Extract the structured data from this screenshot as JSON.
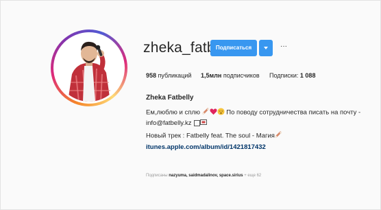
{
  "profile": {
    "username": "zheka_fatbelly",
    "follow_label": "Подписаться",
    "more_label": "···",
    "full_name": "Zheka Fatbelly"
  },
  "stats": {
    "posts": "958",
    "posts_label": "публикаций",
    "followers": "1,5млн",
    "followers_label": "подписчиков",
    "following_label": "Подписки:",
    "following": "1 088"
  },
  "bio": {
    "line1_start": "Ем,люблю и сплю",
    "line1_end": "По поводу сотрудничества писать на почту -",
    "line2": "info@fatbelly.kz",
    "line3": "Новый трек : Fatbelly feat. The soul - Магия",
    "link": "itunes.apple.com/album/id/1421817432"
  },
  "followed_by": {
    "prefix": "Подписаны",
    "users": "nazyuma, saidmadalinov, space.sirius",
    "suffix": "+ еще 62"
  },
  "colors": {
    "accent": "#3897f0",
    "link": "#003569"
  },
  "icons": {
    "bio_emojis": [
      "bone-icon",
      "heart-icon",
      "sleeping-face-icon"
    ],
    "contact_icons": [
      "square-icon",
      "mailbox-icon"
    ],
    "track_icon": "bone-icon"
  }
}
